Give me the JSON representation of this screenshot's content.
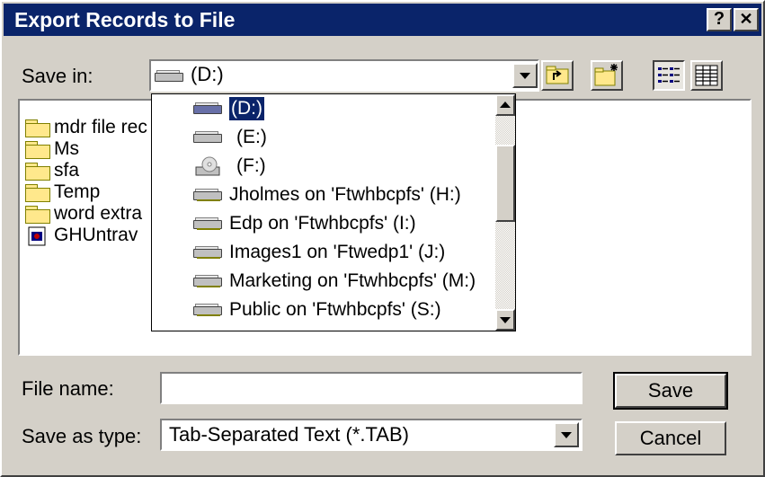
{
  "dialog": {
    "title": "Export Records to File",
    "help_label": "?",
    "close_label": "✕"
  },
  "save_in": {
    "label": "Save in:",
    "value": "(D:)"
  },
  "files": [
    {
      "name": "mdr file rec",
      "icon": "folder-icon"
    },
    {
      "name": "Ms",
      "icon": "folder-icon"
    },
    {
      "name": "sfa",
      "icon": "folder-icon"
    },
    {
      "name": "Temp",
      "icon": "folder-icon"
    },
    {
      "name": "word extra",
      "icon": "folder-icon"
    },
    {
      "name": "GHUntrav",
      "icon": "document-icon"
    }
  ],
  "dropdown": {
    "items": [
      {
        "label": "(D:)",
        "icon": "local-drive-icon",
        "selected": true
      },
      {
        "label": "(E:)",
        "icon": "local-drive-icon"
      },
      {
        "label": "(F:)",
        "icon": "cd-drive-icon"
      },
      {
        "label": "Jholmes on 'Ftwhbcpfs' (H:)",
        "icon": "network-drive-icon"
      },
      {
        "label": "Edp on 'Ftwhbcpfs' (I:)",
        "icon": "network-drive-icon"
      },
      {
        "label": "Images1 on 'Ftwedp1' (J:)",
        "icon": "network-drive-icon"
      },
      {
        "label": "Marketing on 'Ftwhbcpfs' (M:)",
        "icon": "network-drive-icon"
      },
      {
        "label": "Public on 'Ftwhbcpfs' (S:)",
        "icon": "network-drive-icon"
      }
    ]
  },
  "file_name": {
    "label": "File name:",
    "value": ""
  },
  "save_as_type": {
    "label": "Save as type:",
    "value": "Tab-Separated Text (*.TAB)"
  },
  "buttons": {
    "save": "Save",
    "cancel": "Cancel"
  },
  "colors": {
    "titlebar": "#0a246a",
    "selection": "#0a246a",
    "face": "#d4d0c8"
  }
}
